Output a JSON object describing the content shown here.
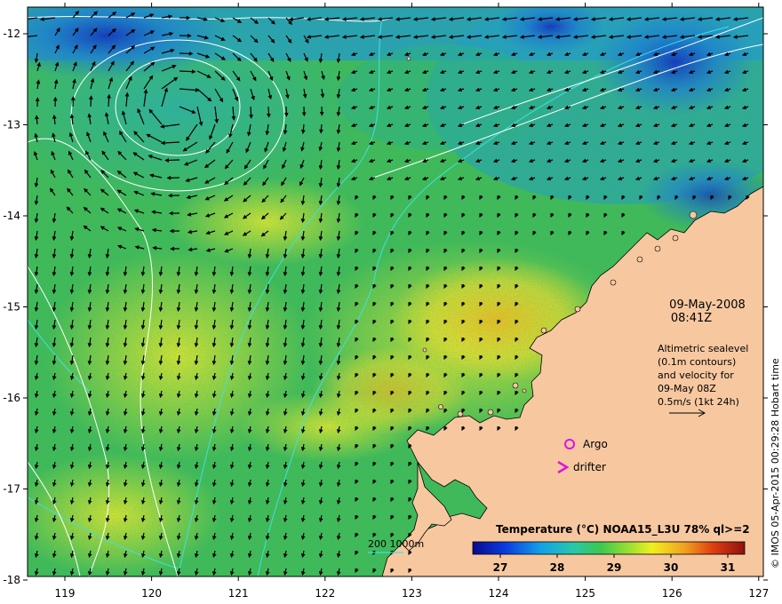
{
  "map": {
    "date": "09-May-2008",
    "time": "08:41Z",
    "altimetry_note": [
      "Altimetric sealevel",
      "(0.1m contours)",
      "and velocity for",
      "09-May 08Z",
      "0.5m/s (1kt 24h)"
    ],
    "legend_markers": {
      "argo": "Argo",
      "drifter": "drifter"
    },
    "depth_legend": "200  1000m",
    "credit": "© IMOS 05-Apr-2015 00:29:28 Hobart time",
    "colorbar": {
      "title": "Temperature (°C) NOAA15_L3U 78% ql>=2",
      "ticks": [
        "27",
        "28",
        "29",
        "30",
        "31"
      ]
    },
    "x_ticks": [
      "119",
      "120",
      "121",
      "122",
      "123",
      "124",
      "125",
      "126",
      "127"
    ],
    "y_ticks": [
      "-12",
      "-13",
      "-14",
      "-15",
      "-16",
      "-17",
      "-18"
    ],
    "colors": {
      "land": "#f7c8a0",
      "argo_marker": "#e010e0",
      "drifter_marker": "#e010e0",
      "isobath": "#40e0e0",
      "contour": "#ffffff"
    }
  }
}
